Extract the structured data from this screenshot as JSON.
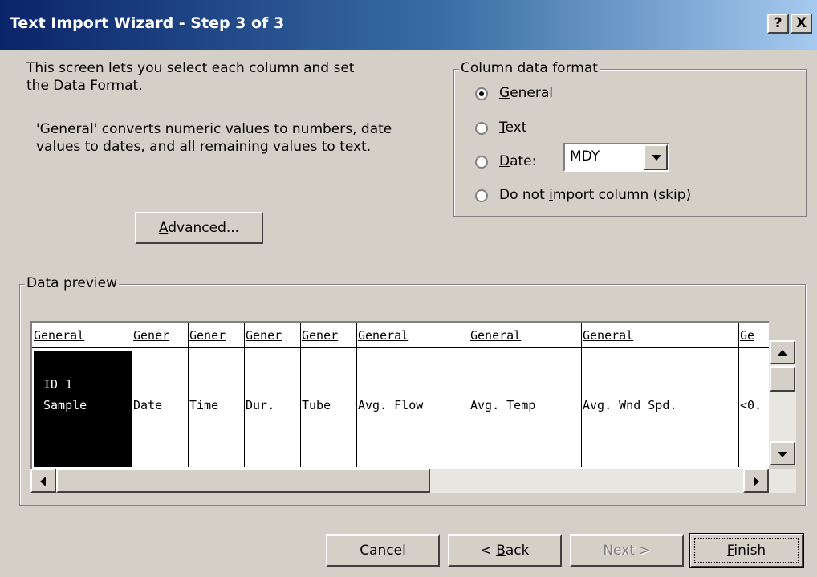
{
  "window": {
    "title": "Text Import Wizard - Step 3 of 3",
    "help_label": "?",
    "close_label": "X"
  },
  "description": {
    "line1": "This screen lets you select each column and set",
    "line2": "the Data Format.",
    "line3": "'General' converts numeric values to numbers, date",
    "line4": "values to dates, and all remaining values to text."
  },
  "advanced_button": {
    "pre": "",
    "accel": "A",
    "post": "dvanced..."
  },
  "column_format": {
    "legend": "Column data format",
    "options": [
      {
        "accel": "G",
        "rest": "eneral",
        "selected": true
      },
      {
        "accel": "T",
        "rest": "ext",
        "selected": false
      },
      {
        "accel": "D",
        "rest": "ate:",
        "selected": false
      },
      {
        "pre": "Do not ",
        "accel": "i",
        "rest": "mport column (skip)",
        "selected": false
      }
    ],
    "date_format": "MDY"
  },
  "preview": {
    "legend": "Data preview",
    "headers": [
      "General",
      "Gener",
      "Gener",
      "Gener",
      "Gener",
      "General",
      "General",
      "General",
      "Ge"
    ],
    "columns": [
      {
        "line1": "ID    1",
        "line2": "Sample",
        "selected": true
      },
      {
        "line1": "",
        "line2": "Date"
      },
      {
        "line1": "",
        "line2": "Time"
      },
      {
        "line1": "",
        "line2": "Dur."
      },
      {
        "line1": "",
        "line2": "Tube"
      },
      {
        "line1": "",
        "line2": "Avg.  Flow"
      },
      {
        "line1": "",
        "line2": "Avg.  Temp"
      },
      {
        "line1": "",
        "line2": "Avg.  Wnd Spd."
      },
      {
        "line1": "",
        "line2": "<0."
      }
    ]
  },
  "buttons": {
    "cancel": "Cancel",
    "back": {
      "pre": "< ",
      "accel": "B",
      "rest": "ack"
    },
    "next": "Next >",
    "finish": {
      "accel": "F",
      "rest": "inish"
    }
  },
  "icons": {
    "scroll_up": "up-arrow-icon",
    "scroll_down": "down-arrow-icon",
    "scroll_left": "left-arrow-icon",
    "scroll_right": "right-arrow-icon",
    "dropdown": "chevron-down-icon"
  }
}
